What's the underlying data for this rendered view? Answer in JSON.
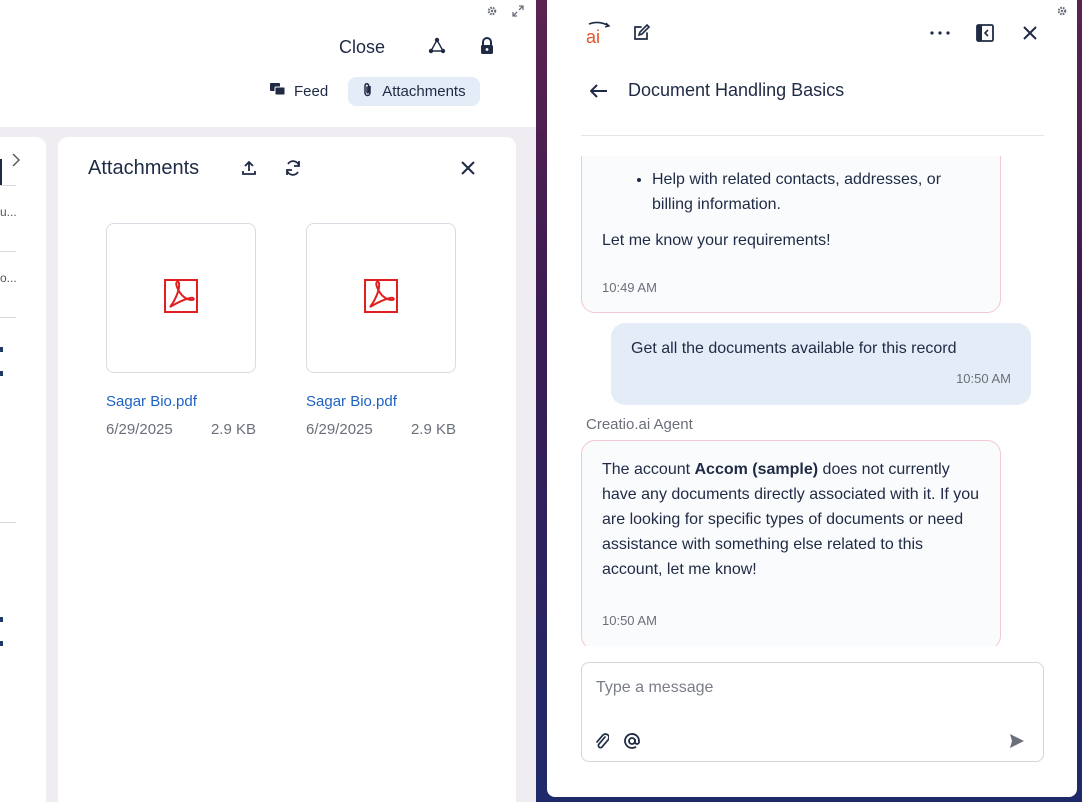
{
  "header": {
    "close_label": "Close",
    "tabs": [
      {
        "label": "Feed",
        "icon": "feed-icon",
        "active": false
      },
      {
        "label": "Attachments",
        "icon": "paperclip-icon",
        "active": true
      }
    ]
  },
  "attachments": {
    "title": "Attachments",
    "files": [
      {
        "name": "Sagar Bio.pdf",
        "date": "6/29/2025",
        "size": "2.9 KB",
        "icon": "pdf-icon"
      },
      {
        "name": "Sagar Bio.pdf",
        "date": "6/29/2025",
        "size": "2.9 KB",
        "icon": "pdf-icon"
      }
    ]
  },
  "side_panel": {
    "snippets": [
      "u...",
      "o..."
    ]
  },
  "chat": {
    "logo_text": "ai",
    "title": "Document Handling Basics",
    "messages": {
      "agent1_bullet": "Help with related contacts, addresses, or billing information.",
      "agent1_text": "Let me know your requirements!",
      "agent1_time": "10:49 AM",
      "user_text": "Get all the documents available for this record",
      "user_time": "10:50 AM",
      "agent_name": "Creatio.ai Agent",
      "agent2_pre": "The account ",
      "agent2_bold": "Accom (sample)",
      "agent2_post": " does not currently have any documents directly associated with it. If you are looking for specific types of documents or need assistance with something else related to this account, let me know!",
      "agent2_time": "10:50 AM"
    },
    "composer": {
      "placeholder": "Type a message"
    }
  },
  "colors": {
    "accent_orange": "#e8542a",
    "pdf_red": "#e02020",
    "link_blue": "#1e63c4",
    "active_tab_bg": "#e4ecf8"
  }
}
